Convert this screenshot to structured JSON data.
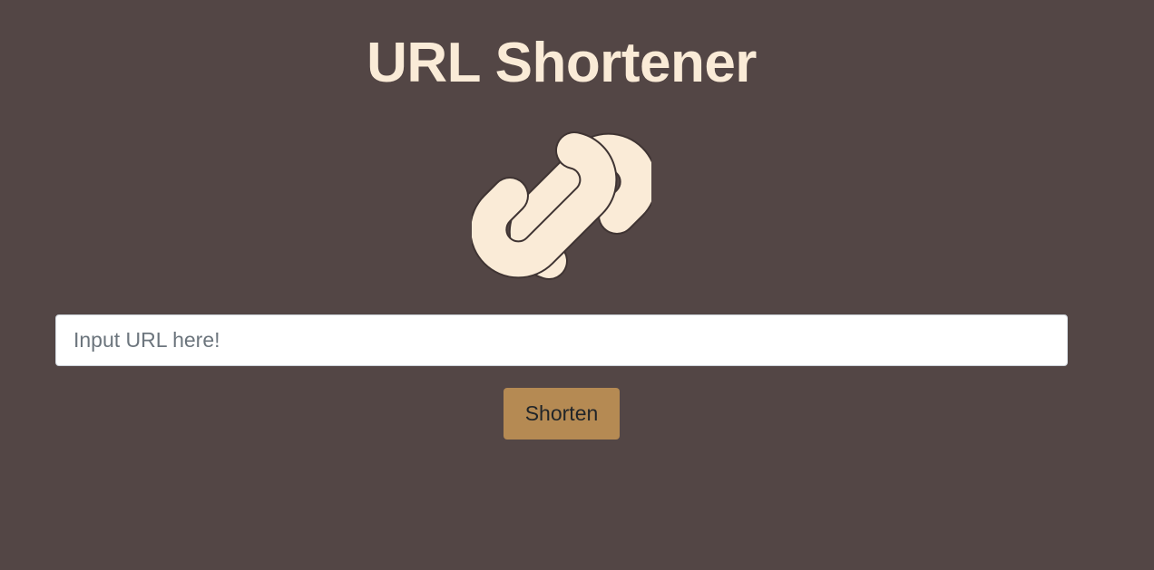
{
  "app": {
    "title": "URL Shortener",
    "logo_icon": "link-icon"
  },
  "form": {
    "url_input": {
      "placeholder": "Input URL here!",
      "value": ""
    },
    "submit_label": "Shorten"
  },
  "colors": {
    "background": "#534645",
    "title": "#FAEBD7",
    "icon": "#FAEBD7",
    "button": "#B58A53",
    "button_text": "#212529",
    "input_background": "#FFFFFF",
    "placeholder": "#6C757D"
  }
}
